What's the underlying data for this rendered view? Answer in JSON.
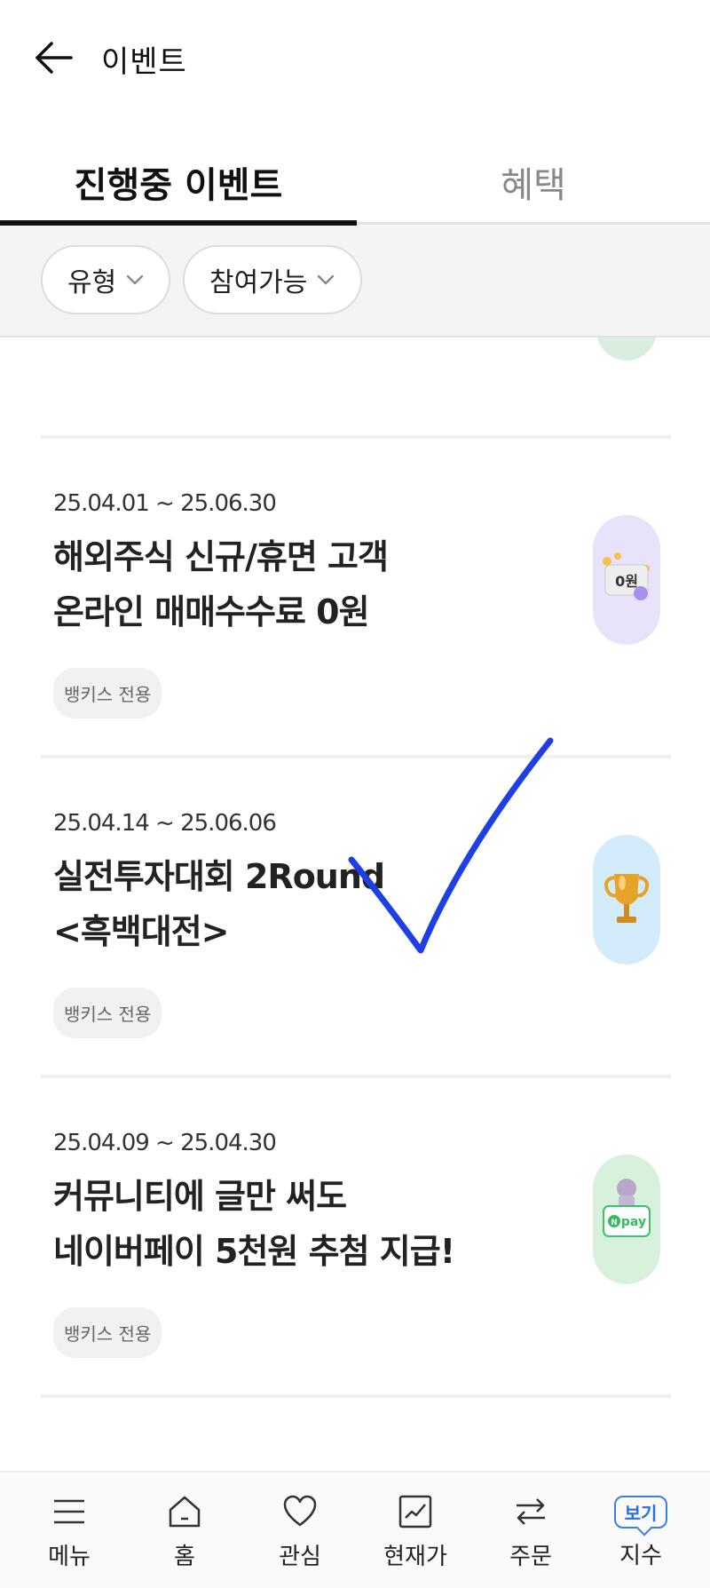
{
  "header": {
    "title": "이벤트"
  },
  "tabs": [
    {
      "label": "진행중 이벤트",
      "active": true
    },
    {
      "label": "혜택",
      "active": false
    }
  ],
  "filters": [
    {
      "label": "유형"
    },
    {
      "label": "참여가능"
    }
  ],
  "events": [
    {
      "date": "25.04.01 ~ 25.06.30",
      "title_line1": "해외주식 신규/휴면 고객",
      "title_line2": "온라인 매매수수료 0원",
      "badge": "뱅키스 전용",
      "thumb_text": "0원",
      "thumb_color": "#e9e2fb"
    },
    {
      "date": "25.04.14 ~ 25.06.06",
      "title_line1": "실전투자대회 2Round",
      "title_line2": "<흑백대전>",
      "badge": "뱅키스 전용",
      "thumb_icon": "trophy-icon",
      "thumb_color": "#d3ecfb"
    },
    {
      "date": "25.04.09 ~ 25.04.30",
      "title_line1": "커뮤니티에 글만 써도",
      "title_line2": "네이버페이 5천원 추첨 지급!",
      "badge": "뱅키스 전용",
      "thumb_text": "pay",
      "thumb_color": "#d8f1dd"
    }
  ],
  "bottom_nav": [
    {
      "label": "메뉴",
      "icon": "menu-icon"
    },
    {
      "label": "홈",
      "icon": "home-icon"
    },
    {
      "label": "관심",
      "icon": "heart-icon"
    },
    {
      "label": "현재가",
      "icon": "chart-icon"
    },
    {
      "label": "주문",
      "icon": "swap-icon"
    },
    {
      "label": "지수",
      "icon": "view-badge",
      "badge": "보기"
    }
  ],
  "colors": {
    "accent_blue": "#2a6fe0",
    "checkmark": "#1f3fe6"
  }
}
